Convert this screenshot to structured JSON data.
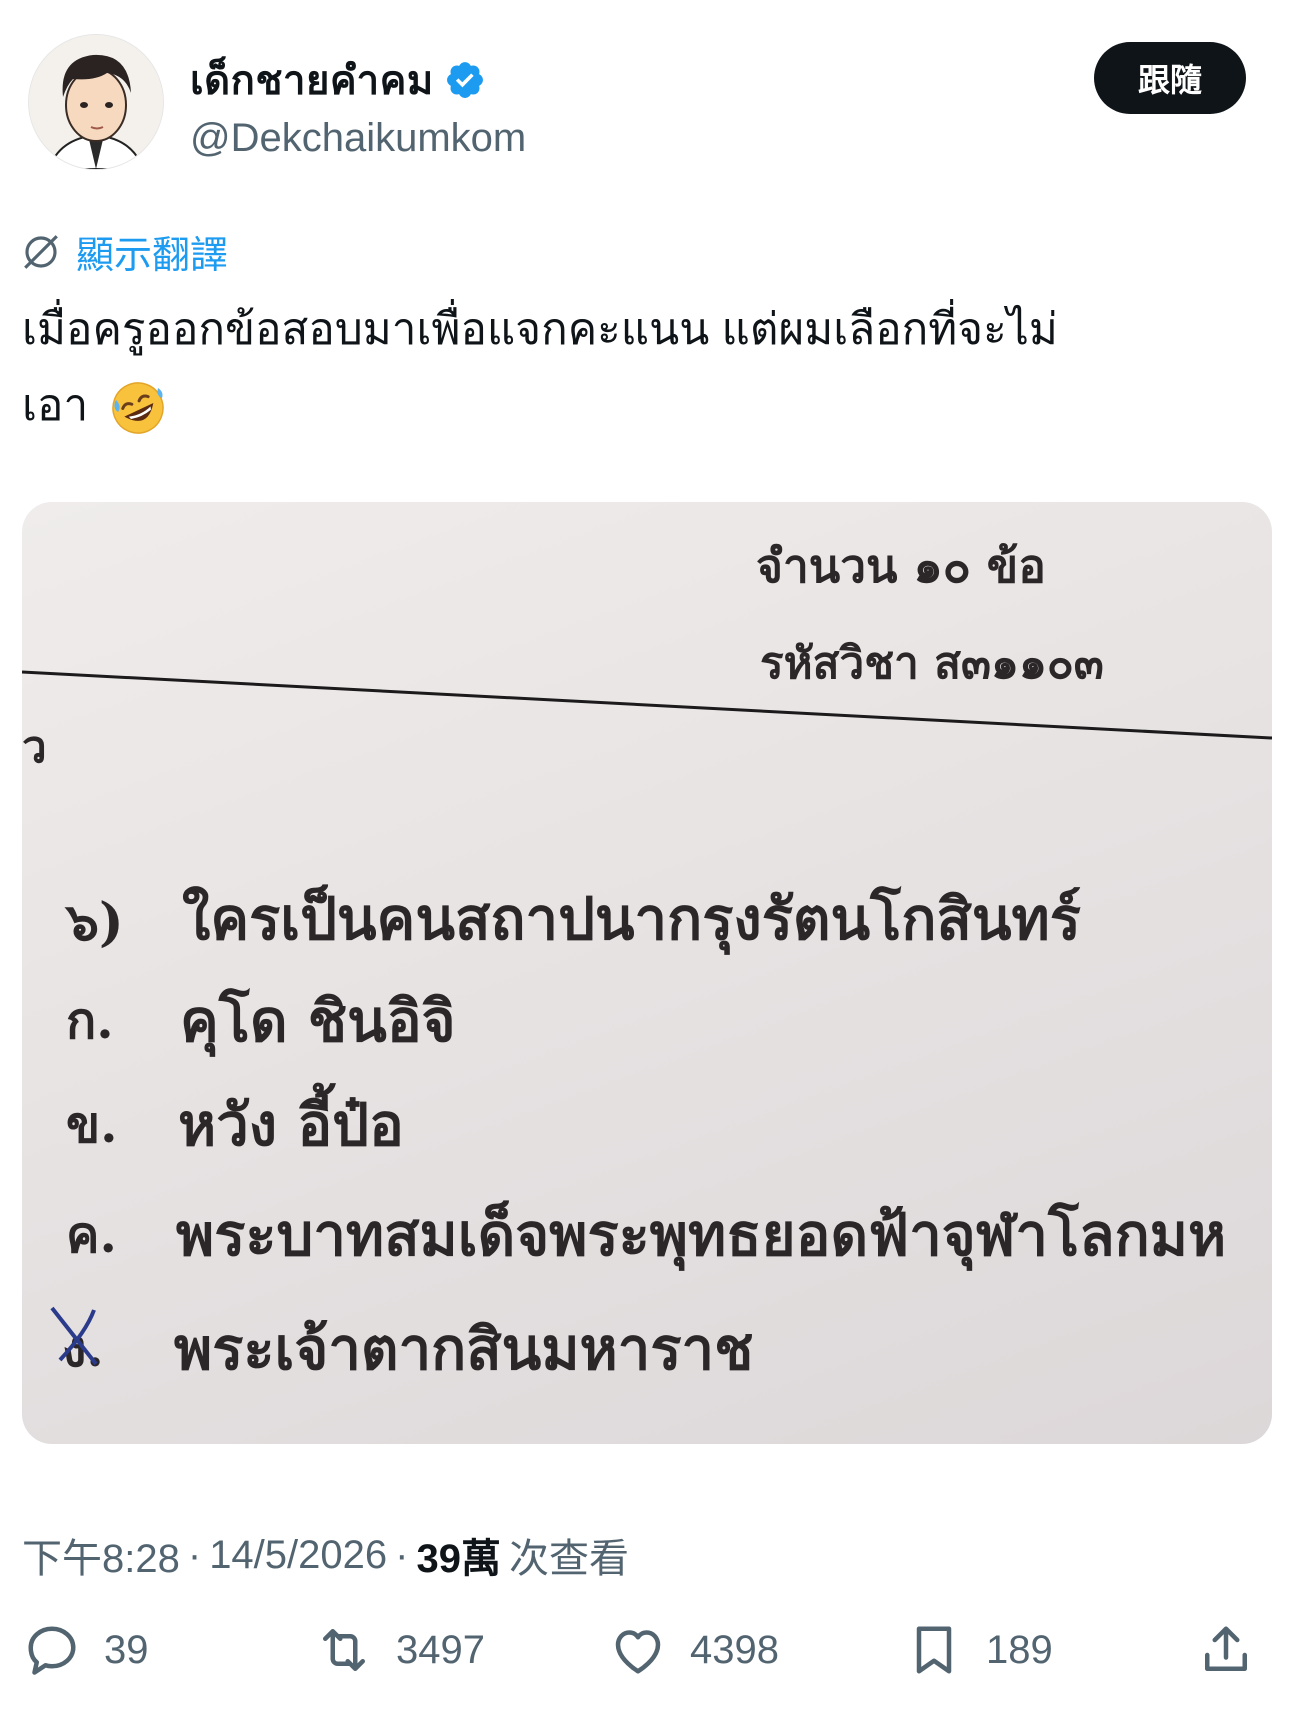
{
  "user": {
    "display_name": "เด็กชายคำคม",
    "handle": "@Dekchaikumkom",
    "verified_color": "#1d9bf0"
  },
  "follow_button": "跟隨",
  "translate": {
    "label": "顯示翻譯",
    "icon": "globe-strike-icon"
  },
  "tweet": {
    "text_line1": "เมื่อครูออกข้อสอบมาเพื่อแจกคะแนน แต่ผมเลือกที่จะไม่",
    "text_line2": "เอา",
    "emoji": "rolling-on-floor-laughing-emoji"
  },
  "photo": {
    "header_count": "จำนวน ๑๐ ข้อ",
    "header_code": "รหัสวิชา ส๓๑๑๐๓",
    "left_fragment": "ว",
    "question_number": "๖)",
    "question_text": "ใครเป็นคนสถาปนากรุงรัตนโกสินทร์",
    "choices": [
      {
        "label": "ก.",
        "text": "คุโด ชินอิจิ"
      },
      {
        "label": "ข.",
        "text": "หวัง อี้ป๋อ"
      },
      {
        "label": "ค.",
        "text": "พระบาทสมเด็จพระพุทธยอดฟ้าจุฬาโลกมห"
      },
      {
        "label": "ง.",
        "text": "พระเจ้าตากสินมหาราช",
        "marked": true
      }
    ]
  },
  "meta": {
    "time": "下午8:28",
    "separator": "·",
    "date": "14/5/2026",
    "views_count": "39萬",
    "views_label": "次查看"
  },
  "actions": {
    "replies": "39",
    "reposts": "3497",
    "likes": "4398",
    "bookmarks": "189"
  }
}
